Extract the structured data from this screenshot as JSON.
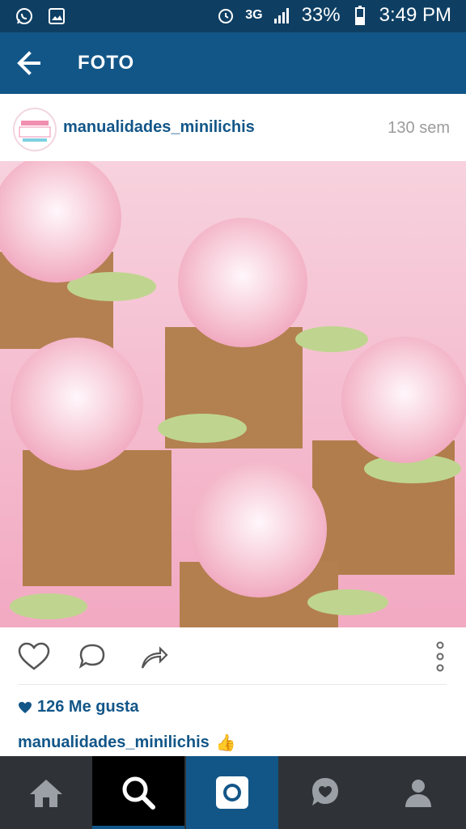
{
  "status_bar": {
    "network": "3G",
    "battery": "33%",
    "time": "3:49 PM"
  },
  "app_bar": {
    "title": "FOTO",
    "icons": [
      "back-arrow-icon"
    ]
  },
  "post": {
    "username": "manualidades_minilichis",
    "time_ago": "130 sem",
    "avatar_text": "Minilichis",
    "likes": "126 Me gusta",
    "caption_user": "manualidades_minilichis",
    "caption_emoji": "👍"
  },
  "actions": [
    "heart-icon",
    "comment-icon",
    "share-icon",
    "more-icon"
  ],
  "bottom_nav": [
    "home-icon",
    "search-icon",
    "camera-icon",
    "activity-icon",
    "profile-icon"
  ],
  "colors": {
    "accent": "#125688",
    "statusbar": "#0e3f63",
    "bottom_bg": "#2f3337"
  }
}
